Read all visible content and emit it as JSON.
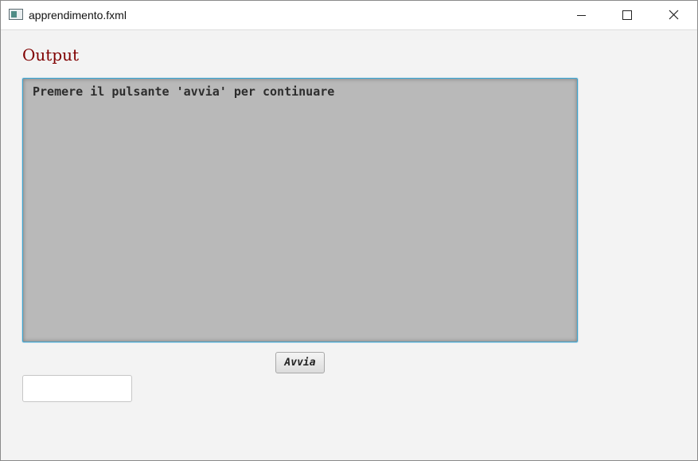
{
  "window": {
    "title": "apprendimento.fxml",
    "controls": {
      "minimize_icon": "minimize-icon",
      "maximize_icon": "maximize-icon",
      "close_icon": "close-icon"
    }
  },
  "main": {
    "section_title": "Output",
    "output_text": "Premere il pulsante 'avvia' per continuare",
    "start_button_label": "Avvia",
    "input_value": "",
    "input_placeholder": ""
  },
  "colors": {
    "title_red": "#800000",
    "output_background": "#b9b9b9",
    "focus_border": "#3fa2cc"
  }
}
